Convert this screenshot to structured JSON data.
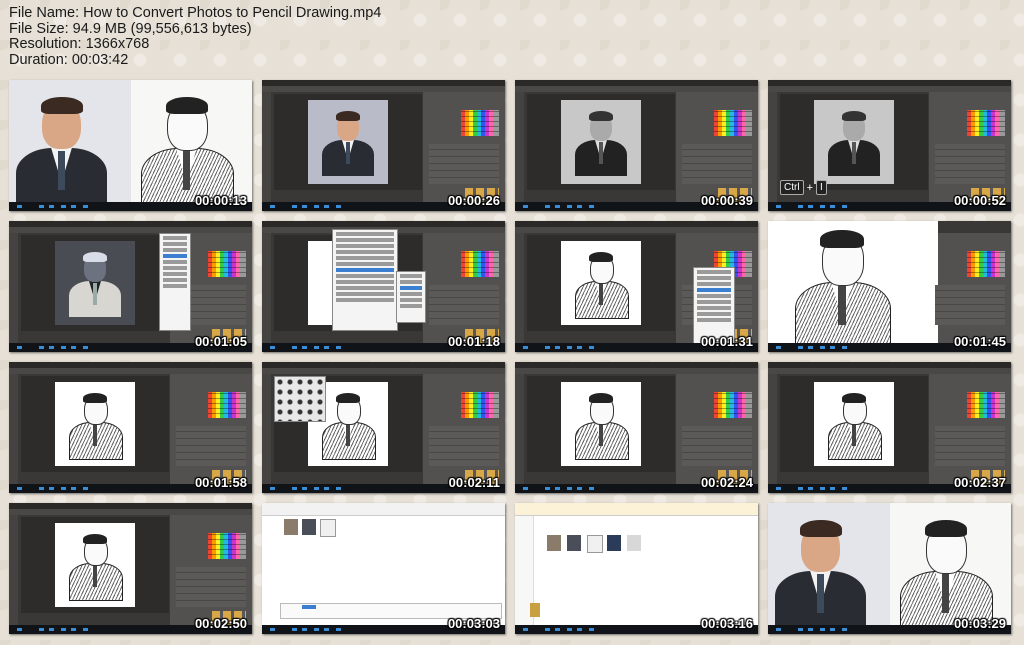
{
  "file_info": {
    "name": "File Name: How to Convert Photos to Pencil Drawing.mp4",
    "size": "File Size: 94.9 MB (99,556,613 bytes)",
    "resolution": "Resolution: 1366x768",
    "duration": "Duration: 00:03:42"
  },
  "thumbnails": [
    {
      "time": "00:00:13",
      "scene": "split-photo-sketch"
    },
    {
      "time": "00:00:26",
      "scene": "photoshop-color"
    },
    {
      "time": "00:00:39",
      "scene": "photoshop-gray"
    },
    {
      "time": "00:00:52",
      "scene": "photoshop-gray-keys"
    },
    {
      "time": "00:01:05",
      "scene": "photoshop-invert"
    },
    {
      "time": "00:01:18",
      "scene": "photoshop-menu"
    },
    {
      "time": "00:01:31",
      "scene": "photoshop-sketch-menu"
    },
    {
      "time": "00:01:45",
      "scene": "photoshop-sketch-large"
    },
    {
      "time": "00:01:58",
      "scene": "photoshop-sketch"
    },
    {
      "time": "00:02:11",
      "scene": "photoshop-sketch-brushes"
    },
    {
      "time": "00:02:24",
      "scene": "photoshop-sketch"
    },
    {
      "time": "00:02:37",
      "scene": "photoshop-sketch"
    },
    {
      "time": "00:02:50",
      "scene": "photoshop-sketch"
    },
    {
      "time": "00:03:03",
      "scene": "explorer-save"
    },
    {
      "time": "00:03:16",
      "scene": "explorer-files"
    },
    {
      "time": "00:03:29",
      "scene": "split-photo-sketch"
    }
  ],
  "key_hint": {
    "key1": "Ctrl",
    "plus": "+",
    "key2": "I"
  }
}
